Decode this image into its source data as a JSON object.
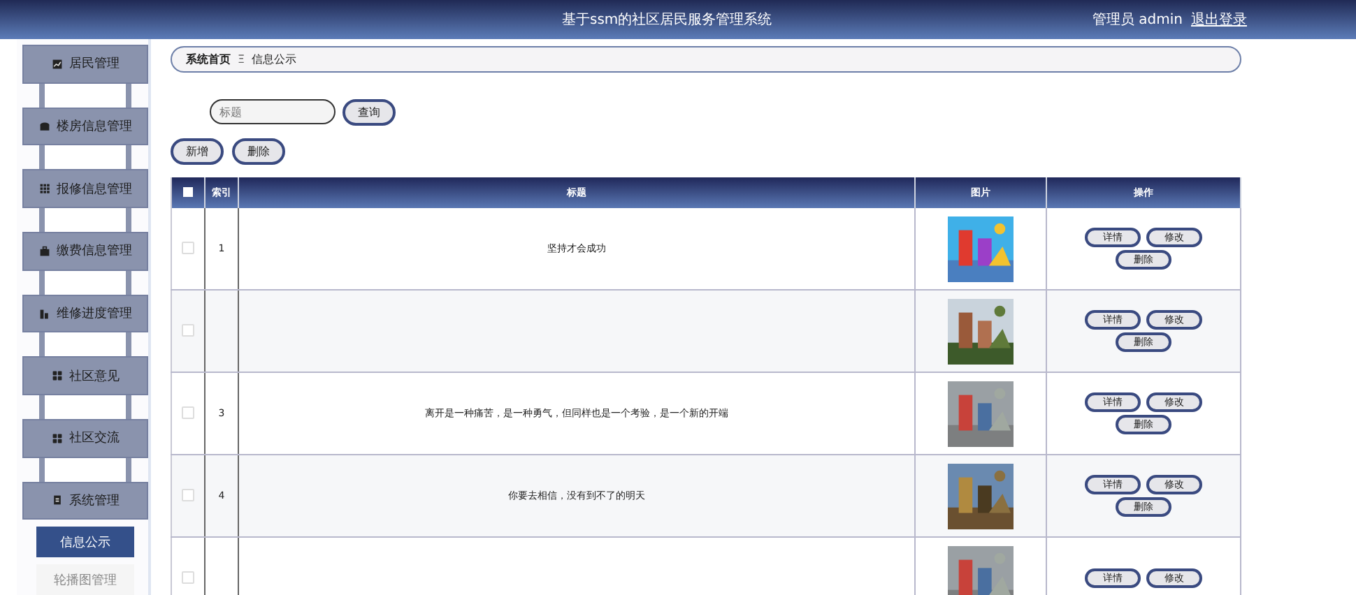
{
  "header": {
    "title": "基于ssm的社区居民服务管理系统",
    "user_label": "管理员 admin",
    "logout": "退出登录"
  },
  "sidebar": {
    "items": [
      {
        "label": "居民管理"
      },
      {
        "label": "楼房信息管理"
      },
      {
        "label": "报修信息管理"
      },
      {
        "label": "缴费信息管理"
      },
      {
        "label": "维修进度管理"
      },
      {
        "label": "社区意见"
      },
      {
        "label": "社区交流"
      },
      {
        "label": "系统管理",
        "expanded": true,
        "children": [
          {
            "label": "信息公示",
            "selected": true
          },
          {
            "label": "轮播图管理",
            "selected": false
          }
        ]
      }
    ]
  },
  "breadcrumb": {
    "home": "系统首页",
    "separator": "Ξ",
    "current": "信息公示"
  },
  "search": {
    "placeholder": "标题",
    "button": "查询"
  },
  "actions": [
    "新增",
    "删除"
  ],
  "table": {
    "all_checked": false,
    "columns": [
      "索引",
      "标题",
      "图片",
      "操作"
    ],
    "rows": [
      {
        "index": "1",
        "title": "坚持才会成功",
        "checked": false,
        "buttons": [
          "详情",
          "修改",
          "删除"
        ]
      },
      {
        "checked": false,
        "buttons": [
          "详情",
          "修改",
          "删除"
        ]
      },
      {
        "index": "3",
        "title": "离开是一种痛苦，是一种勇气，但同样也是一个考验，是一个新的开端",
        "checked": false,
        "buttons": [
          "详情",
          "修改",
          "删除"
        ]
      },
      {
        "index": "4",
        "title": "你要去相信，没有到不了的明天",
        "checked": false,
        "buttons": [
          "详情",
          "修改",
          "删除"
        ]
      },
      {
        "checked": false,
        "buttons": [
          "详情",
          "修改"
        ]
      }
    ]
  }
}
